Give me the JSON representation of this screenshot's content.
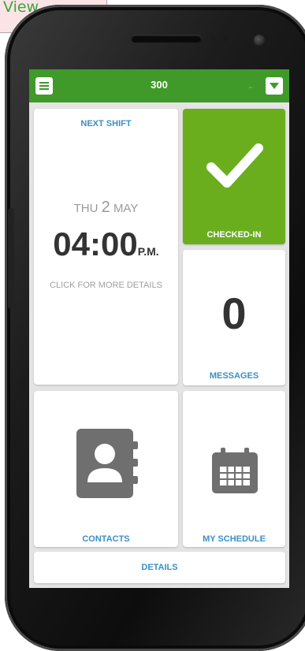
{
  "overlay_tag": {
    "label": "View"
  },
  "header": {
    "title": "300",
    "dash": "-"
  },
  "next_shift": {
    "label": "NEXT SHIFT",
    "day": "THU",
    "date": "2",
    "month": "MAY",
    "time": "04:00",
    "ampm": "P.M.",
    "hint": "CLICK FOR MORE DETAILS"
  },
  "checkin": {
    "label": "CHECKED-IN"
  },
  "messages": {
    "count": "0",
    "label": "MESSAGES"
  },
  "contacts": {
    "label": "CONTACTS"
  },
  "schedule": {
    "label": "MY SCHEDULE"
  },
  "details": {
    "label": "DETAILS"
  },
  "colors": {
    "brand_green": "#3f9a2a",
    "checkin_green": "#6aae1e",
    "link_blue": "#3a8fc8"
  },
  "icons": [
    "menu-icon",
    "dropdown-icon",
    "checkmark-icon",
    "contacts-book-icon",
    "calendar-icon"
  ]
}
